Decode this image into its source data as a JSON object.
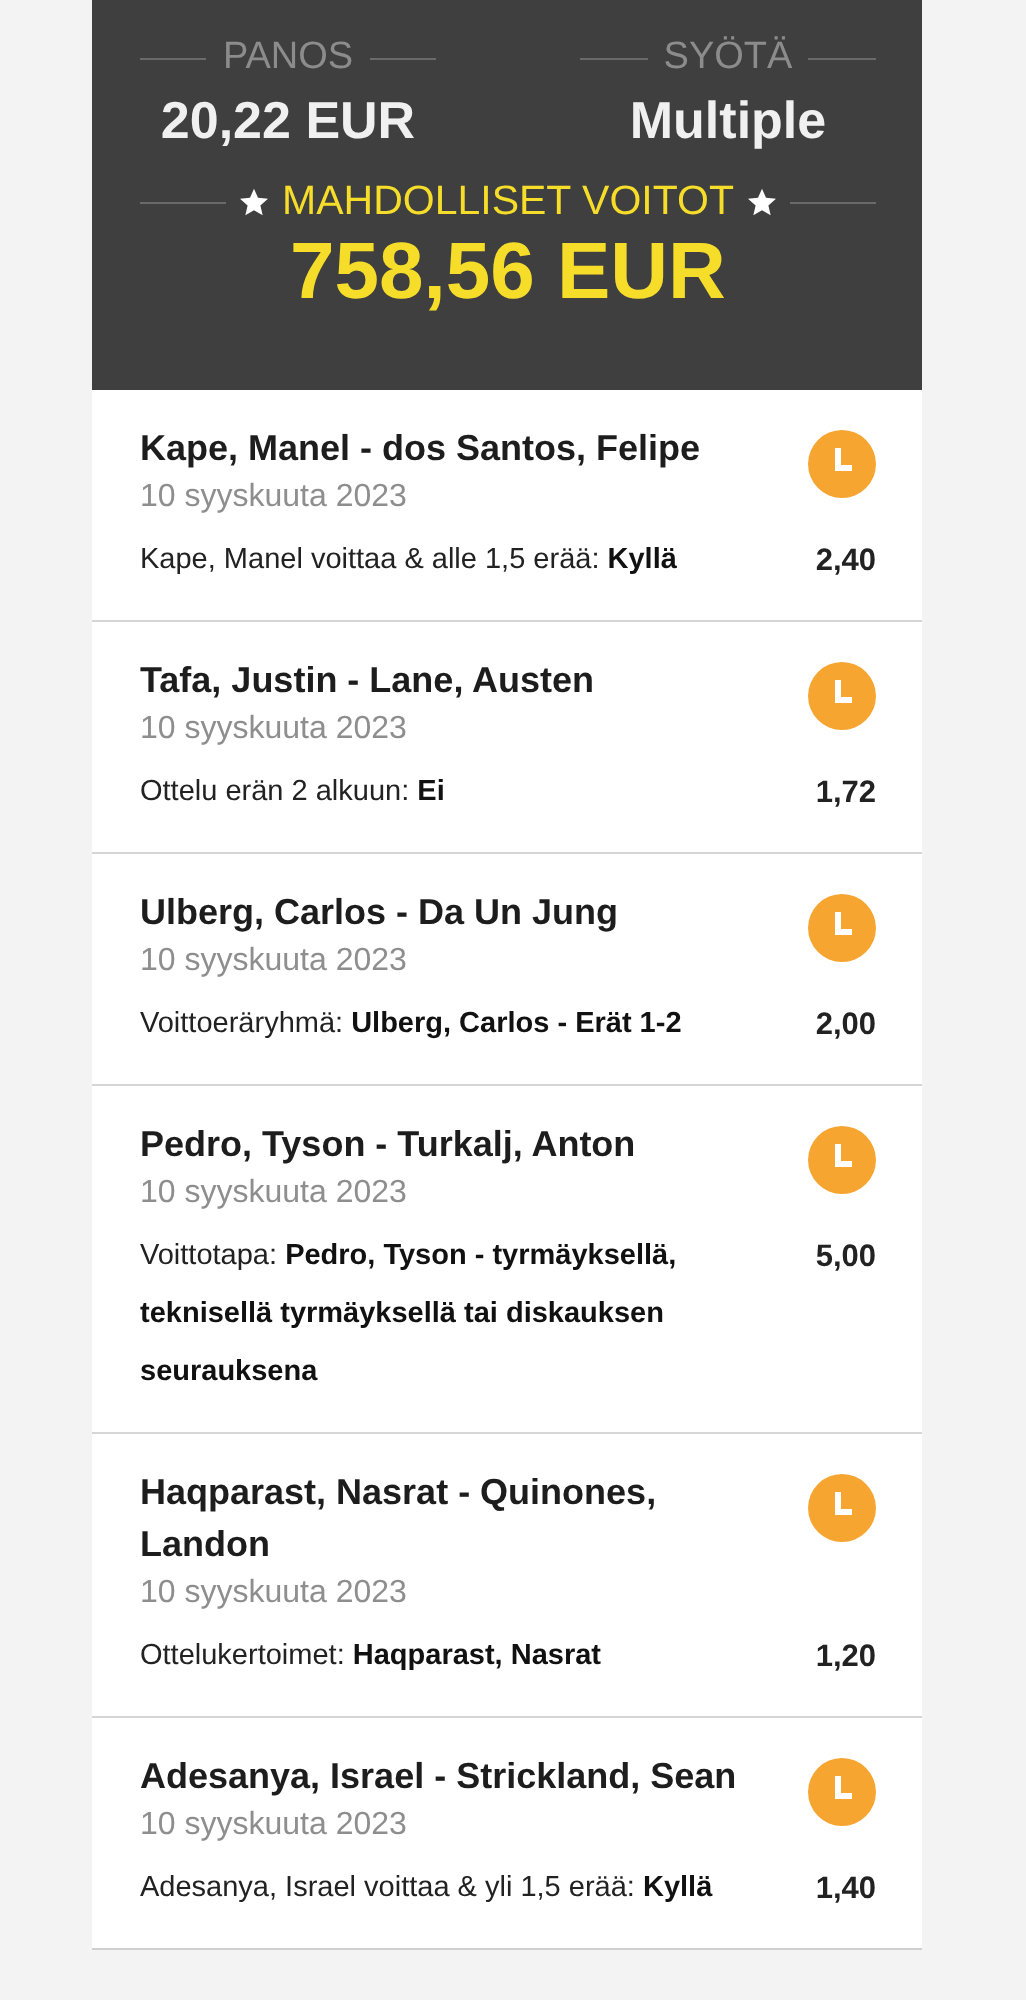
{
  "summary": {
    "stake_label": "PANOS",
    "stake": "20,22 EUR",
    "type_label": "SYÖTÄ",
    "type": "Multiple",
    "winnings_label": "MAHDOLLISET VOITOT",
    "winnings": "758,56 EUR"
  },
  "bets": [
    {
      "title": "Kape, Manel - dos Santos, Felipe",
      "date": "10 syyskuuta 2023",
      "selection": "Kape, Manel voittaa & alle 1,5 erää: **Kyllä**",
      "odds": "2,40"
    },
    {
      "title": "Tafa, Justin - Lane, Austen",
      "date": "10 syyskuuta 2023",
      "selection": "Ottelu erän 2 alkuun: **Ei**",
      "odds": "1,72"
    },
    {
      "title": "Ulberg, Carlos - Da Un Jung",
      "date": "10 syyskuuta 2023",
      "selection": "Voittoeräryhmä: **Ulberg, Carlos - Erät 1-2**",
      "odds": "2,00"
    },
    {
      "title": "Pedro, Tyson - Turkalj, Anton",
      "date": "10 syyskuuta 2023",
      "selection": "Voittotapa: **Pedro, Tyson - tyrmäyksellä, teknisellä tyrmäyksellä tai diskauksen seurauksena**",
      "odds": "5,00"
    },
    {
      "title": "Haqparast, Nasrat - Quinones, Landon",
      "date": "10 syyskuuta 2023",
      "selection": "Ottelukertoimet: **Haqparast, Nasrat**",
      "odds": "1,20"
    },
    {
      "title": "Adesanya, Israel - Strickland, Sean",
      "date": "10 syyskuuta 2023",
      "selection": "Adesanya, Israel voittaa & yli 1,5 erää: **Kyllä**",
      "odds": "1,40"
    }
  ]
}
